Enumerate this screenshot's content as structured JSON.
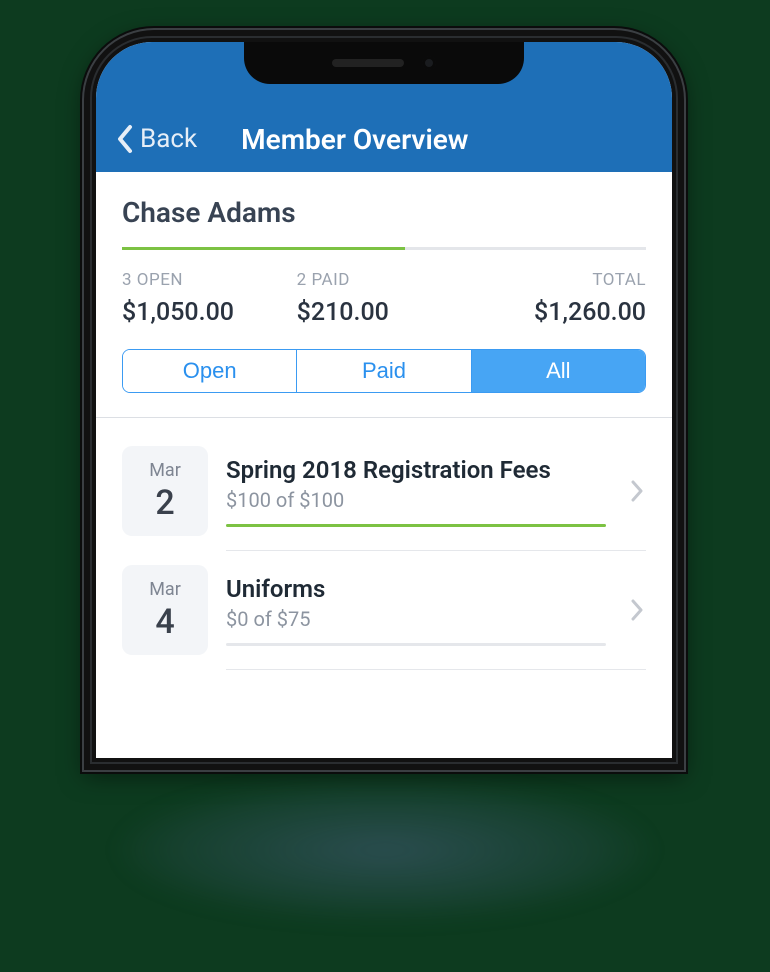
{
  "header": {
    "back_label": "Back",
    "title": "Member Overview"
  },
  "member": {
    "name": "Chase Adams"
  },
  "summary": {
    "open": {
      "label": "3 OPEN",
      "value": "$1,050.00"
    },
    "paid": {
      "label": "2 PAID",
      "value": "$210.00"
    },
    "total": {
      "label": "TOTAL",
      "value": "$1,260.00"
    }
  },
  "segments": {
    "open": "Open",
    "paid": "Paid",
    "all": "All",
    "active": "all"
  },
  "items": [
    {
      "month": "Mar",
      "day": "2",
      "title": "Spring 2018 Registration Fees",
      "sub": "$100 of $100",
      "progress_pct": 100
    },
    {
      "month": "Mar",
      "day": "4",
      "title": "Uniforms",
      "sub": "$0 of $75",
      "progress_pct": 0
    }
  ]
}
